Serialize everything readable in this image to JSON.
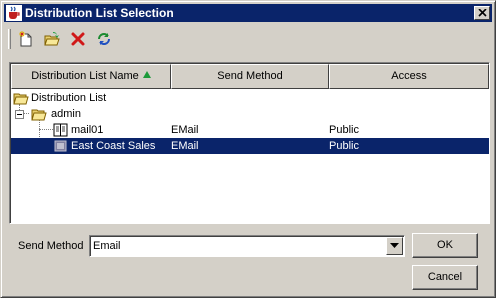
{
  "window": {
    "title": "Distribution List Selection"
  },
  "toolbar": {
    "buttons": [
      {
        "icon": "new-icon"
      },
      {
        "icon": "open-folder-icon"
      },
      {
        "icon": "delete-icon"
      },
      {
        "icon": "refresh-icon"
      }
    ]
  },
  "table": {
    "columns": [
      {
        "label": "Distribution List Name",
        "sorted": "ascending"
      },
      {
        "label": "Send Method"
      },
      {
        "label": "Access"
      }
    ],
    "tree": [
      {
        "name": "Distribution List",
        "icon": "folder-open-icon",
        "level": 0,
        "send_method": "",
        "access": ""
      },
      {
        "name": "admin",
        "icon": "folder-open-icon",
        "level": 1,
        "expanded": true,
        "send_method": "",
        "access": ""
      },
      {
        "name": "mail01",
        "icon": "address-book-icon",
        "level": 2,
        "send_method": "EMail",
        "access": "Public",
        "selected": false
      },
      {
        "name": "East Coast Sales",
        "icon": "group-list-icon",
        "level": 2,
        "send_method": "EMail",
        "access": "Public",
        "selected": true
      }
    ]
  },
  "send_method": {
    "label": "Send Method",
    "value": "Email"
  },
  "buttons": {
    "ok_label": "OK",
    "cancel_label": "Cancel"
  },
  "colors": {
    "title_bar": "#0a246a",
    "selection": "#0a246a",
    "dialog_bg": "#d4d0c8"
  }
}
